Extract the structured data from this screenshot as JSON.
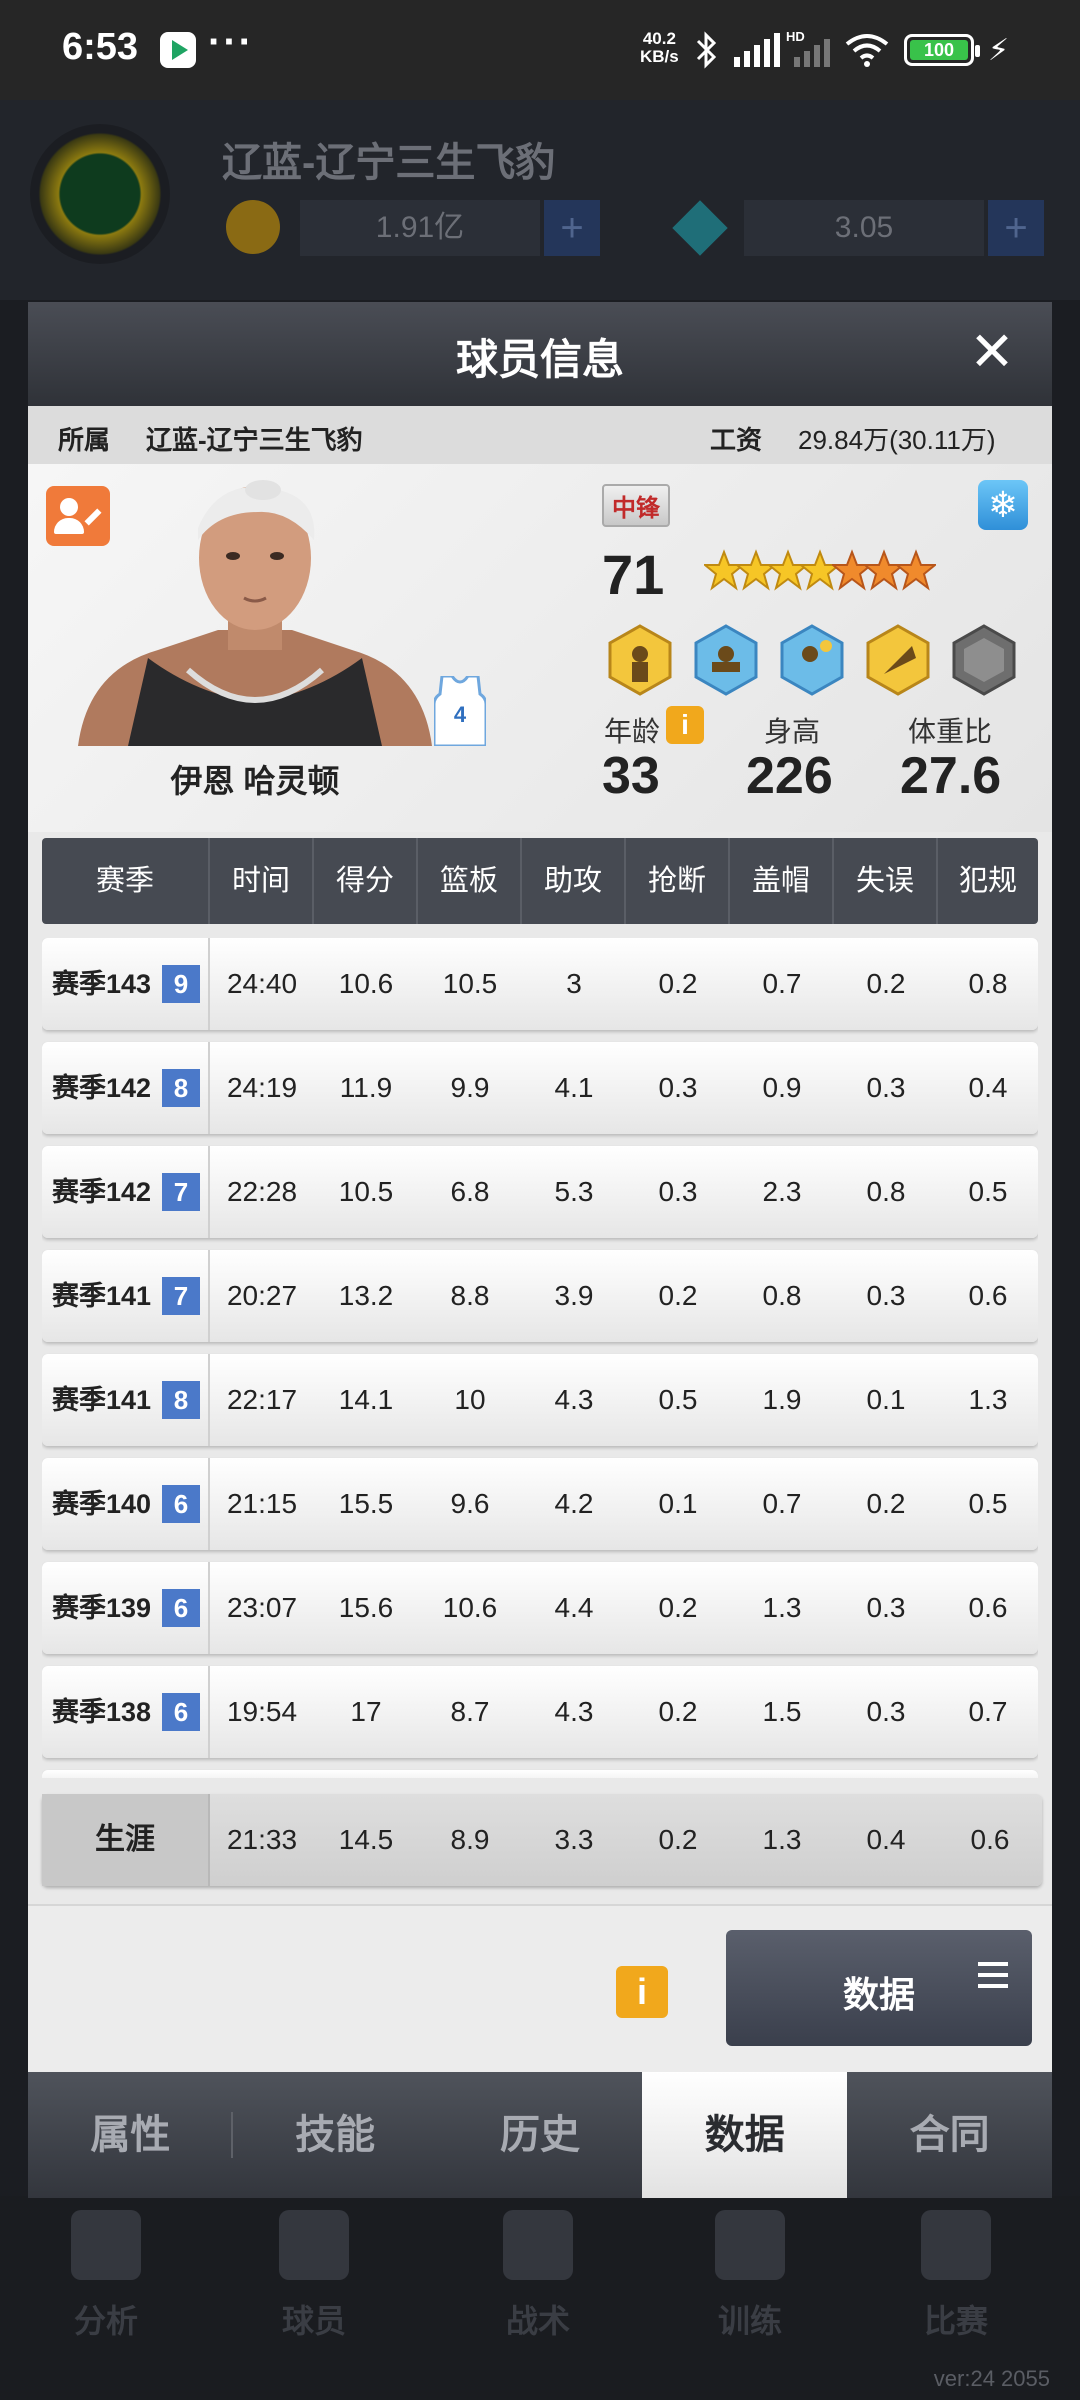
{
  "status_bar": {
    "time": "6:53",
    "more": "···",
    "net_speed_value": "40.2",
    "net_speed_unit": "KB/s",
    "hd": "HD",
    "battery": "100"
  },
  "background": {
    "team_name": "辽蓝-辽宁三生飞豹",
    "coins": "1.91亿",
    "gems": "3.05",
    "nav_items": [
      "分析",
      "球员",
      "战术",
      "训练",
      "比赛"
    ],
    "version": "ver:24  2055"
  },
  "modal": {
    "title": "球员信息",
    "team_label": "所属",
    "team_value": "辽蓝-辽宁三生飞豹",
    "salary_label": "工资",
    "salary_value": "29.84万(30.11万)",
    "player": {
      "name": "伊恩 哈灵顿",
      "jersey_number": "4",
      "position": "中锋",
      "rating": "71",
      "stars_gold": 4,
      "stars_orange": 3,
      "age_label": "年龄",
      "age": "33",
      "height_label": "身高",
      "height": "226",
      "weight_label": "体重比",
      "weight": "27.6",
      "info_icon": "i"
    },
    "table": {
      "headers": [
        "赛季",
        "时间",
        "得分",
        "篮板",
        "助攻",
        "抢断",
        "盖帽",
        "失误",
        "犯规"
      ],
      "rows": [
        {
          "season": "赛季143",
          "level": "9",
          "time": "24:40",
          "pts": "10.6",
          "reb": "10.5",
          "ast": "3",
          "stl": "0.2",
          "blk": "0.7",
          "tov": "0.2",
          "pf": "0.8"
        },
        {
          "season": "赛季142",
          "level": "8",
          "time": "24:19",
          "pts": "11.9",
          "reb": "9.9",
          "ast": "4.1",
          "stl": "0.3",
          "blk": "0.9",
          "tov": "0.3",
          "pf": "0.4"
        },
        {
          "season": "赛季142",
          "level": "7",
          "time": "22:28",
          "pts": "10.5",
          "reb": "6.8",
          "ast": "5.3",
          "stl": "0.3",
          "blk": "2.3",
          "tov": "0.8",
          "pf": "0.5"
        },
        {
          "season": "赛季141",
          "level": "7",
          "time": "20:27",
          "pts": "13.2",
          "reb": "8.8",
          "ast": "3.9",
          "stl": "0.2",
          "blk": "0.8",
          "tov": "0.3",
          "pf": "0.6"
        },
        {
          "season": "赛季141",
          "level": "8",
          "time": "22:17",
          "pts": "14.1",
          "reb": "10",
          "ast": "4.3",
          "stl": "0.5",
          "blk": "1.9",
          "tov": "0.1",
          "pf": "1.3"
        },
        {
          "season": "赛季140",
          "level": "6",
          "time": "21:15",
          "pts": "15.5",
          "reb": "9.6",
          "ast": "4.2",
          "stl": "0.1",
          "blk": "0.7",
          "tov": "0.2",
          "pf": "0.5"
        },
        {
          "season": "赛季139",
          "level": "6",
          "time": "23:07",
          "pts": "15.6",
          "reb": "10.6",
          "ast": "4.4",
          "stl": "0.2",
          "blk": "1.3",
          "tov": "0.3",
          "pf": "0.6"
        },
        {
          "season": "赛季138",
          "level": "6",
          "time": "19:54",
          "pts": "17",
          "reb": "8.7",
          "ast": "4.3",
          "stl": "0.2",
          "blk": "1.5",
          "tov": "0.3",
          "pf": "0.7"
        }
      ],
      "career": {
        "label": "生涯",
        "time": "21:33",
        "pts": "14.5",
        "reb": "8.9",
        "ast": "3.3",
        "stl": "0.2",
        "blk": "1.3",
        "tov": "0.4",
        "pf": "0.6"
      }
    },
    "footer": {
      "info_icon": "i",
      "data_button": "数据"
    },
    "tabs": [
      "属性",
      "技能",
      "历史",
      "数据",
      "合同"
    ],
    "active_tab": "数据"
  },
  "colors": {
    "level_badge": "#4b79c9",
    "info_orange": "#f1a81c",
    "edit_orange": "#f07a3a",
    "position_red": "#c12a2a"
  },
  "icons": [
    "play-store-icon",
    "bluetooth-icon",
    "signal-icon",
    "wifi-icon",
    "battery-icon",
    "close-icon",
    "edit-profile-icon",
    "snowflake-icon",
    "jersey-icon",
    "star-icon",
    "skill-badge-icon",
    "info-icon",
    "menu-icon"
  ]
}
